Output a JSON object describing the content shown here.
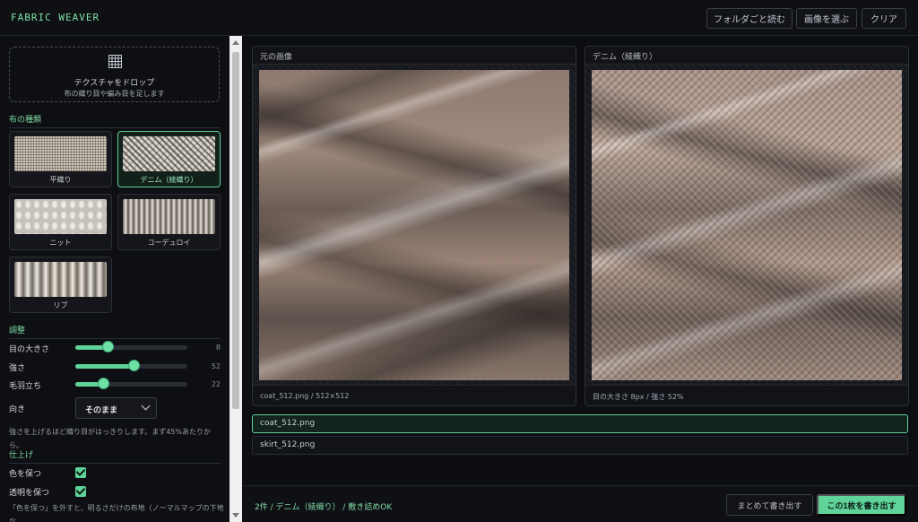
{
  "app": {
    "title": "FABRIC WEAVER"
  },
  "toolbar": {
    "load_folder": "フォルダごと読む",
    "choose_image": "画像を選ぶ",
    "clear": "クリア"
  },
  "dropzone": {
    "title": "テクスチャをドロップ",
    "subtitle": "布の織り目や編み目を足します",
    "icon": "grid-icon"
  },
  "fabric": {
    "heading": "布の種類",
    "selected": "デニム（綾織り）",
    "items": [
      {
        "label": "平織り"
      },
      {
        "label": "デニム（綾織り）"
      },
      {
        "label": "ニット"
      },
      {
        "label": "コーデュロイ"
      },
      {
        "label": "リブ"
      }
    ]
  },
  "adjust": {
    "heading": "調整",
    "sliders": [
      {
        "label": "目の大きさ",
        "value": 8,
        "fraction": 0.29
      },
      {
        "label": "強さ",
        "value": 52,
        "fraction": 0.52
      },
      {
        "label": "毛羽立ち",
        "value": 22,
        "fraction": 0.25
      }
    ],
    "direction": {
      "label": "向き",
      "value": "そのまま"
    },
    "note": "強さを上げるほど織り目がはっきりします。まず45%あたりから。"
  },
  "finish": {
    "heading": "仕上げ",
    "keep_color": {
      "label": "色を保つ",
      "checked": true
    },
    "keep_alpha": {
      "label": "透明を保つ",
      "checked": true
    },
    "note": "「色を保つ」を外すと、明るさだけの布地（ノーマルマップの下地な"
  },
  "preview": {
    "original": {
      "title": "元の画像",
      "caption": "coat_512.png / 512×512"
    },
    "result": {
      "title": "デニム（綾織り）",
      "caption": "目の大きさ 8px / 強さ 52%"
    }
  },
  "files": [
    {
      "name": "coat_512.png",
      "selected": true
    },
    {
      "name": "skirt_512.png",
      "selected": false
    }
  ],
  "footer": {
    "status": "2件 / デニム（綾織り） / 敷き詰めOK",
    "export_all": "まとめて書き出す",
    "export_one": "この1枚を書き出す"
  },
  "colors": {
    "accent": "#5fd39a",
    "background": "#0d0e12"
  }
}
